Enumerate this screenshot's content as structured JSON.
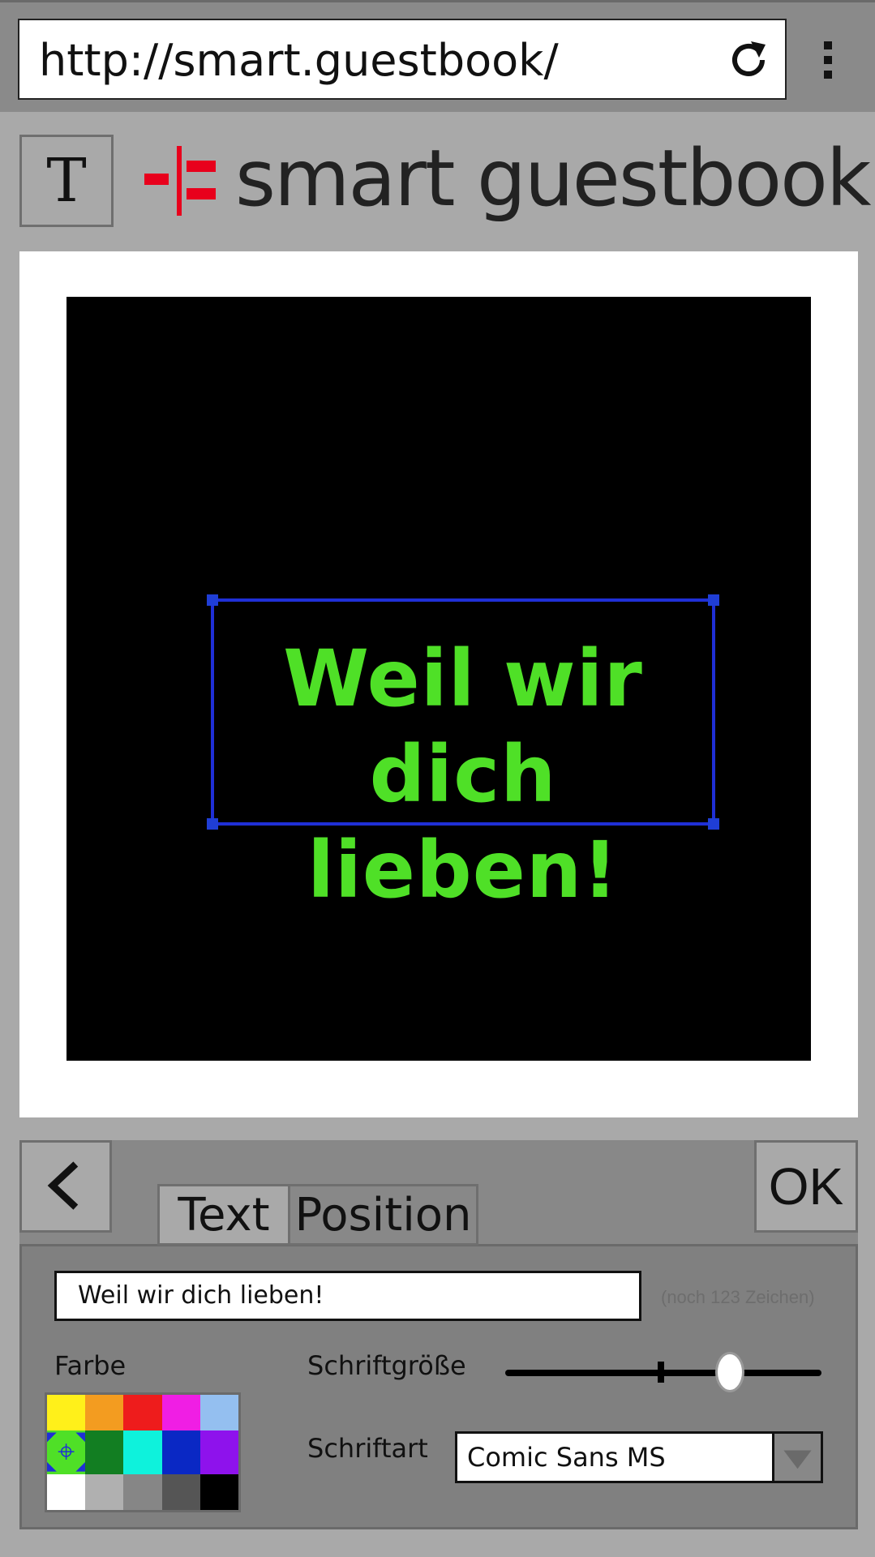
{
  "browser": {
    "url": "http://smart.guestbook/",
    "reload_icon": "reload-icon",
    "menu_icon": "vertical-dots-icon"
  },
  "header": {
    "text_tool_label": "T",
    "logo_text": "smart guestbook",
    "logo_icon": "smart-guestbook-logo-mark",
    "logo_color": "#e8001c"
  },
  "canvas": {
    "text_line1": "Weil wir",
    "text_line2": "dich lieben!",
    "text_color": "#4fe027",
    "background_color": "#000000",
    "selection_color": "#1f2fd6"
  },
  "panel": {
    "back_icon": "chevron-left-icon",
    "ok_label": "OK",
    "tabs": [
      {
        "label": "Text",
        "active": true
      },
      {
        "label": "Position",
        "active": false
      }
    ],
    "text_input_value": "Weil wir dich lieben!",
    "char_count": "(noch 123 Zeichen)",
    "color_label": "Farbe",
    "font_size_label": "Schriftgröße",
    "font_size_value": 0.71,
    "font_label": "Schriftart",
    "font_value": "Comic Sans MS",
    "palette": [
      "#fff01a",
      "#f39c20",
      "#ee1c1c",
      "#f01ee4",
      "#94bff0",
      "#4fe027",
      "#127e22",
      "#0ef2dc",
      "#0a28c4",
      "#8e12ec",
      "#ffffff",
      "#b0b0b0",
      "#868686",
      "#555555",
      "#000000"
    ],
    "selected_color_index": 5
  }
}
